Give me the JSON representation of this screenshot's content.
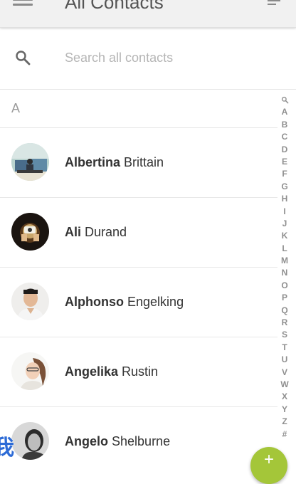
{
  "header": {
    "title": "All Contacts",
    "menu_icon": "menu-icon",
    "sort_icon": "sort-icon"
  },
  "search": {
    "placeholder": "Search all contacts",
    "icon": "search-icon"
  },
  "section": {
    "letter": "A"
  },
  "contacts": [
    {
      "first": "Albertina",
      "last": "Brittain",
      "avatar": "photo"
    },
    {
      "first": "Ali",
      "last": "Durand",
      "avatar": "photo"
    },
    {
      "first": "Alphonso",
      "last": "Engelking",
      "avatar": "photo"
    },
    {
      "first": "Angelika",
      "last": "Rustin",
      "avatar": "photo"
    },
    {
      "first": "Angelo",
      "last": "Shelburne",
      "avatar": "photo"
    }
  ],
  "index": [
    "A",
    "B",
    "C",
    "D",
    "E",
    "F",
    "G",
    "H",
    "I",
    "J",
    "K",
    "L",
    "M",
    "N",
    "O",
    "P",
    "Q",
    "R",
    "S",
    "T",
    "U",
    "V",
    "W",
    "X",
    "Y",
    "Z",
    "#"
  ],
  "fab": {
    "label": "+"
  },
  "watermark": {
    "text": "我"
  },
  "colors": {
    "accent": "#a4c639",
    "appbar": "#f1f1f1",
    "watermark": "#2d6bd6"
  }
}
